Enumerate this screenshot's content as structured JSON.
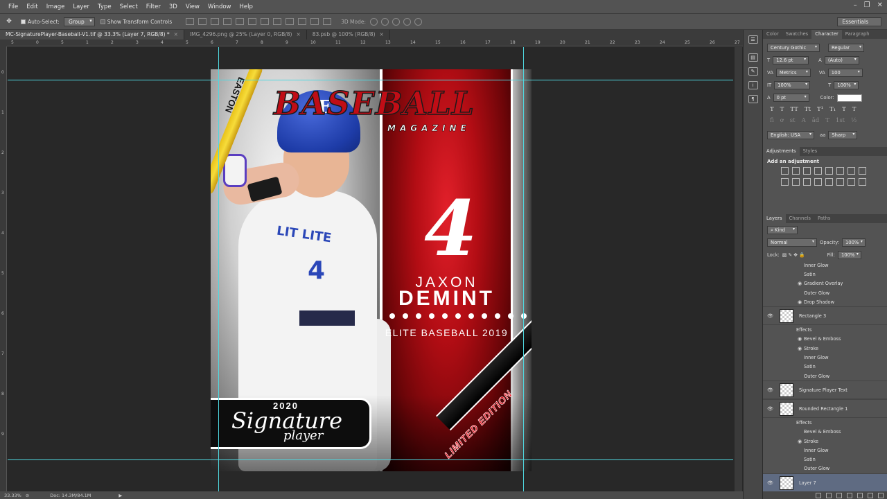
{
  "menu": [
    "File",
    "Edit",
    "Image",
    "Layer",
    "Type",
    "Select",
    "Filter",
    "3D",
    "View",
    "Window",
    "Help"
  ],
  "options": {
    "auto_select": "Auto-Select:",
    "auto_select_value": "Group",
    "show_transform": "Show Transform Controls",
    "mode_3d": "3D Mode:",
    "workspace": "Essentials"
  },
  "tabs": [
    {
      "label": "MC-SignaturePlayer-Baseball-V1.tif @ 33.3% (Layer 7, RGB/8) *",
      "close": "×"
    },
    {
      "label": "IMG_4296.png @ 25% (Layer 0, RGB/8)",
      "close": "×"
    },
    {
      "label": "83.psb @ 100% (RGB/8)",
      "close": "×"
    }
  ],
  "ruler_h": [
    "5",
    "0",
    "5",
    "1",
    "2",
    "3",
    "4",
    "5",
    "6",
    "7",
    "8",
    "9",
    "10",
    "11",
    "12",
    "13",
    "14",
    "15",
    "16",
    "17",
    "18",
    "19",
    "20",
    "21",
    "22",
    "23",
    "24",
    "25",
    "26",
    "27"
  ],
  "ruler_v": [
    "0",
    "1",
    "2",
    "3",
    "4",
    "5",
    "6",
    "7",
    "8",
    "9"
  ],
  "card": {
    "title": "BASEBALL",
    "subtitle": "MAGAZINE",
    "bat_brand": "EASTON",
    "helmet_letter": "E",
    "jersey_text": "LIT LITE",
    "jersey_number": "4",
    "big_number": "4",
    "first_name": "JAXON",
    "last_name": "DEMINT",
    "team": "ELITE BASEBALL 2019",
    "sig_year": "2020",
    "sig_main": "Signature",
    "sig_sub": "player",
    "limited": "LIMITED EDITION"
  },
  "status": {
    "zoom": "33.33%",
    "doc": "Doc: 14.3M/84.1M"
  },
  "character_panel": {
    "tabs": [
      "Color",
      "Swatches",
      "Character",
      "Paragraph"
    ],
    "font_family": "Century Gothic",
    "font_style": "Regular",
    "size": "12.6 pt",
    "leading": "(Auto)",
    "kerning": "Metrics",
    "tracking": "100",
    "vscale": "100%",
    "hscale": "100%",
    "baseline": "0 pt",
    "color_label": "Color:",
    "color": "#ffffff",
    "language": "English: USA",
    "aa_label": "aa",
    "antialias": "Sharp",
    "glyphs_row1": [
      "T",
      "T",
      "TT",
      "Tt",
      "T¹",
      "T₁",
      "T",
      "T"
    ],
    "glyphs_row2": [
      "fi",
      "ơ",
      "st",
      "A",
      "ād",
      "T",
      "1st",
      "½"
    ]
  },
  "adjustments_panel": {
    "tabs": [
      "Adjustments",
      "Styles"
    ],
    "title": "Add an adjustment"
  },
  "layers_panel": {
    "tabs": [
      "Layers",
      "Channels",
      "Paths"
    ],
    "kind": "Kind",
    "blend": "Normal",
    "opacity_label": "Opacity:",
    "opacity": "100%",
    "lock_label": "Lock:",
    "fill_label": "Fill:",
    "fill": "100%",
    "rows": [
      {
        "type": "sub",
        "label": "Inner Glow"
      },
      {
        "type": "sub",
        "label": "Satin"
      },
      {
        "type": "eff",
        "label": "Gradient Overlay"
      },
      {
        "type": "sub",
        "label": "Outer Glow"
      },
      {
        "type": "eff",
        "label": "Drop Shadow"
      },
      {
        "type": "layer",
        "label": "Rectangle 3"
      },
      {
        "type": "fx",
        "label": "Effects"
      },
      {
        "type": "eff",
        "label": "Bevel & Emboss"
      },
      {
        "type": "eff",
        "label": "Stroke"
      },
      {
        "type": "sub",
        "label": "Inner Glow"
      },
      {
        "type": "sub",
        "label": "Satin"
      },
      {
        "type": "sub",
        "label": "Outer Glow"
      },
      {
        "type": "layer",
        "label": "Signature Player Text"
      },
      {
        "type": "layer",
        "label": "Rounded Rectangle 1"
      },
      {
        "type": "fx",
        "label": "Effects"
      },
      {
        "type": "sub",
        "label": "Bevel & Emboss"
      },
      {
        "type": "eff",
        "label": "Stroke"
      },
      {
        "type": "sub",
        "label": "Inner Glow"
      },
      {
        "type": "sub",
        "label": "Satin"
      },
      {
        "type": "sub",
        "label": "Outer Glow"
      },
      {
        "type": "layer",
        "label": "Layer 7",
        "selected": true
      }
    ]
  }
}
